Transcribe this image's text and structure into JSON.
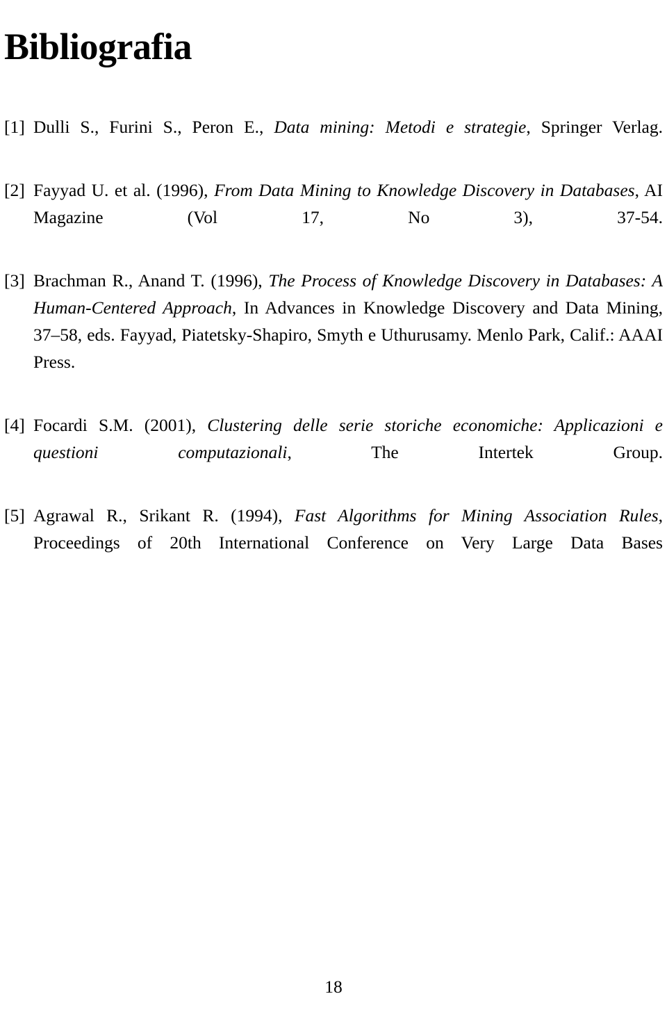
{
  "document": {
    "title": "Bibliografia",
    "page_number": "18",
    "background_color": "#ffffff",
    "text_color": "#000000"
  },
  "bibliography": {
    "entries": [
      {
        "label": "[1]",
        "authors": "Dulli S., Furini S., Peron E., ",
        "work_title": "Data mining: Metodi e strategie",
        "tail": ", Springer Verlag.",
        "plain_text": "Dulli S., Furini S., Peron E., Data mining: Metodi e strategie, Springer Verlag."
      },
      {
        "label": "[2]",
        "authors": "Fayyad U. et al. (1996), ",
        "work_title": "From Data Mining to Knowledge Discovery in Databases",
        "tail": ", AI Magazine (Vol 17, No 3), 37-54.",
        "plain_text": "Fayyad U. et al. (1996), From Data Mining to Knowledge Discovery in Databases, AI Magazine (Vol 17, No 3), 37-54."
      },
      {
        "label": "[3]",
        "authors": "Brachman R., Anand T. (1996), ",
        "work_title": "The Process of Knowledge Discovery in Databases: A Human-Centered Approach",
        "tail": ", In Advances in Knowledge Discovery and Data Mining, 37–58, eds. Fayyad, Piatetsky-Shapiro, Smyth e Uthurusamy. Menlo Park, Calif.: AAAI Press.",
        "plain_text": "Brachman R., Anand T. (1996), The Process of Knowledge Discovery in Databases: A Human-Centered Approach, In Advances in Knowledge Discovery and Data Mining, 37–58, eds. Fayyad, Piatetsky-Shapiro, Smyth e Uthurusamy. Menlo Park, Calif.: AAAI Press."
      },
      {
        "label": "[4]",
        "authors": "Focardi S.M. (2001), ",
        "work_title": "Clustering delle serie storiche economiche: Applicazioni e questioni computazionali",
        "tail": ", The Intertek Group.",
        "plain_text": "Focardi S.M. (2001), Clustering delle serie storiche economiche: Applicazioni e questioni computazionali, The Intertek Group."
      },
      {
        "label": "[5]",
        "authors": "Agrawal R., Srikant R. (1994), ",
        "work_title": "Fast Algorithms for Mining Association Rules",
        "tail": ", Proceedings of 20th International Conference on Very Large Data Bases",
        "plain_text": "Agrawal R., Srikant R. (1994), Fast Algorithms for Mining Association Rules, Proceedings of 20th International Conference on Very Large Data Bases"
      }
    ]
  }
}
